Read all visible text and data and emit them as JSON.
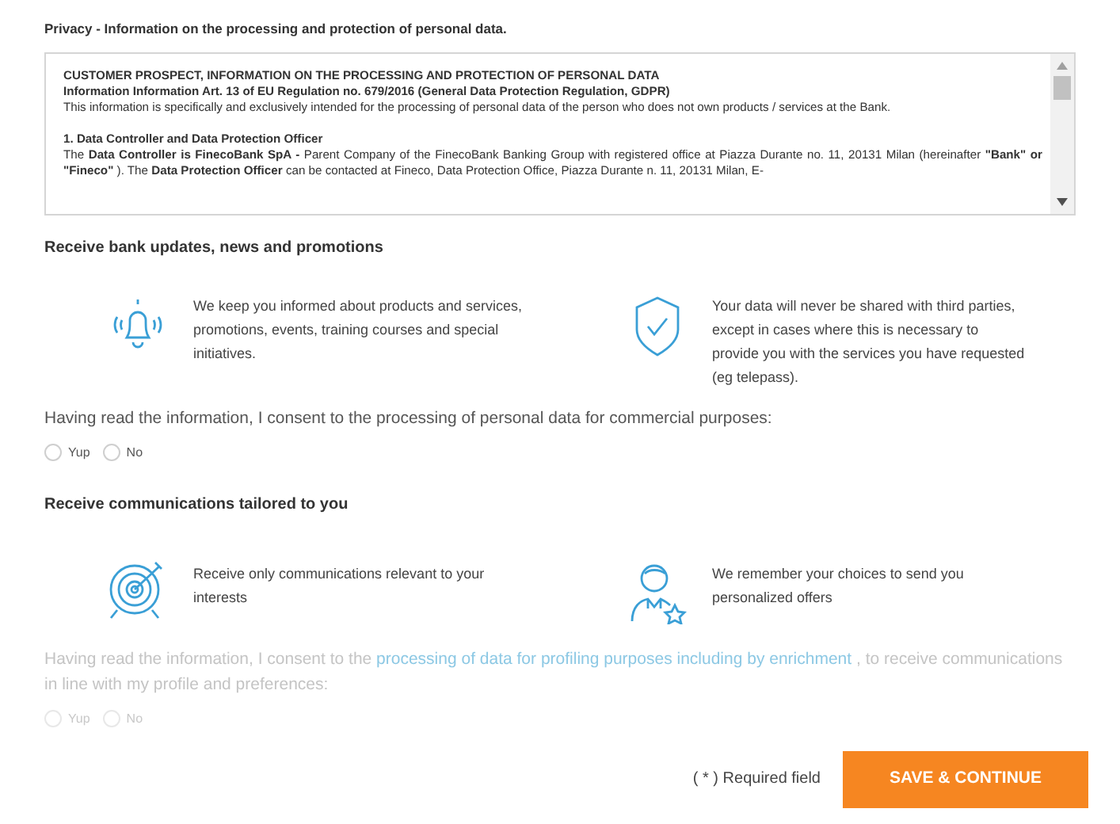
{
  "privacy": {
    "title": "Privacy - Information on the processing and protection of personal data.",
    "paragraphs": [
      {
        "kind": "heading",
        "text": "CUSTOMER PROSPECT, INFORMATION ON THE PROCESSING AND PROTECTION OF PERSONAL DATA"
      },
      {
        "kind": "heading",
        "text": "Information Information Art. 13 of EU Regulation no. 679/2016 (General Data Protection Regulation, GDPR)"
      },
      {
        "kind": "text",
        "text": "This information is specifically and exclusively intended for the processing of personal data of the person who does not own products / services at the Bank."
      },
      {
        "kind": "spacer"
      },
      {
        "kind": "heading",
        "text": "1. Data Controller and Data Protection Officer"
      },
      {
        "kind": "text",
        "text": "The **Data Controller is FinecoBank SpA -** Parent Company of the FinecoBank Banking Group with registered office at Piazza Durante no. 11, 20131 Milan (hereinafter **\"Bank\" or \"Fineco\"** ). The **Data Protection Officer** can be contacted at Fineco, Data Protection Office, Piazza Durante n. 11, 20131 Milan, E-"
      }
    ]
  },
  "sections": [
    {
      "title": "Receive bank updates, news and promotions",
      "disabled": false,
      "features": [
        {
          "kind": "bell",
          "text": "We keep you informed about products and services, promotions, events, training courses and special initiatives."
        },
        {
          "kind": "shield",
          "text": "Your data will never be shared with third parties, except in cases where this is necessary to provide you with the services you have requested (eg telepass)."
        }
      ],
      "consent": {
        "before": "Having read the information, I consent to the processing of personal data for commercial purposes:"
      },
      "options": [
        {
          "label": "Yup",
          "selected": false
        },
        {
          "label": "No",
          "selected": false
        }
      ]
    },
    {
      "title": "Receive communications tailored to you",
      "disabled": true,
      "features": [
        {
          "kind": "target",
          "text": "Receive only communications relevant to your interests"
        },
        {
          "kind": "person",
          "text": "We remember your choices to send you personalized offers"
        }
      ],
      "consent": {
        "before": "Having read the information, I consent to the ",
        "link": "processing of data for profiling purposes including by enrichment",
        "after": " , to receive communications in line with my profile and preferences:"
      },
      "options": [
        {
          "label": "Yup",
          "selected": false
        },
        {
          "label": "No",
          "selected": false
        }
      ]
    }
  ],
  "footer": {
    "note": "( * ) Required field",
    "button": "SAVE & CONTINUE"
  }
}
